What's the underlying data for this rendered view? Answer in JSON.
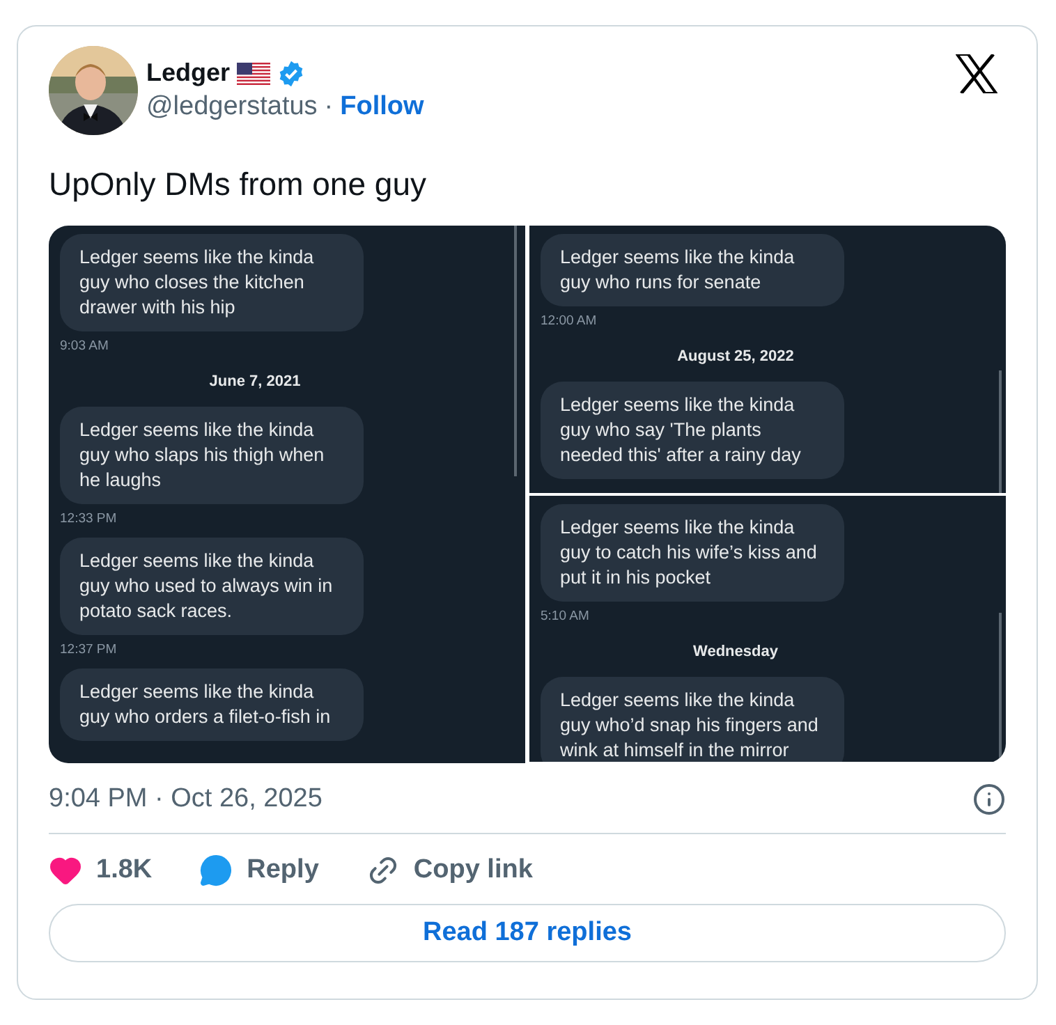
{
  "author": {
    "name": "Ledger",
    "handle": "@ledgerstatus",
    "separator": "·",
    "follow": "Follow",
    "verified": true
  },
  "text": "UpOnly DMs from one guy",
  "media": [
    {
      "items": [
        {
          "kind": "message",
          "text": "Ledger seems like the kinda guy who closes the kitchen drawer with his hip"
        },
        {
          "kind": "time",
          "text": "9:03 AM"
        },
        {
          "kind": "date",
          "text": "June 7, 2021"
        },
        {
          "kind": "message",
          "text": "Ledger seems like the kinda guy who slaps his thigh when he laughs"
        },
        {
          "kind": "time",
          "text": "12:33 PM"
        },
        {
          "kind": "message",
          "text": "Ledger seems like the kinda guy who used to always win in potato sack races."
        },
        {
          "kind": "time",
          "text": "12:37 PM"
        },
        {
          "kind": "message",
          "text": "Ledger seems like the kinda guy who orders a filet-o-fish in"
        }
      ]
    },
    {
      "items": [
        {
          "kind": "message",
          "text": "Ledger seems like the kinda guy who runs for senate"
        },
        {
          "kind": "time",
          "text": "12:00 AM"
        },
        {
          "kind": "date",
          "text": "August 25, 2022"
        },
        {
          "kind": "message",
          "text": "Ledger seems like the kinda guy who say 'The plants needed this' after a rainy day"
        }
      ]
    },
    {
      "items": [
        {
          "kind": "message",
          "text": "Ledger seems like the kinda guy to catch his wife’s kiss and put it in his pocket"
        },
        {
          "kind": "time",
          "text": "5:10 AM"
        },
        {
          "kind": "date",
          "text": "Wednesday"
        },
        {
          "kind": "message",
          "text": "Ledger seems like the kinda guy who’d snap his fingers and wink at himself in the mirror"
        }
      ]
    }
  ],
  "timestamp": "9:04 PM · Oct 26, 2025",
  "actions": [
    {
      "kind": "like",
      "label": "1.8K"
    },
    {
      "kind": "reply",
      "label": "Reply"
    },
    {
      "kind": "copy",
      "label": "Copy link"
    }
  ],
  "read_replies": "Read 187 replies"
}
